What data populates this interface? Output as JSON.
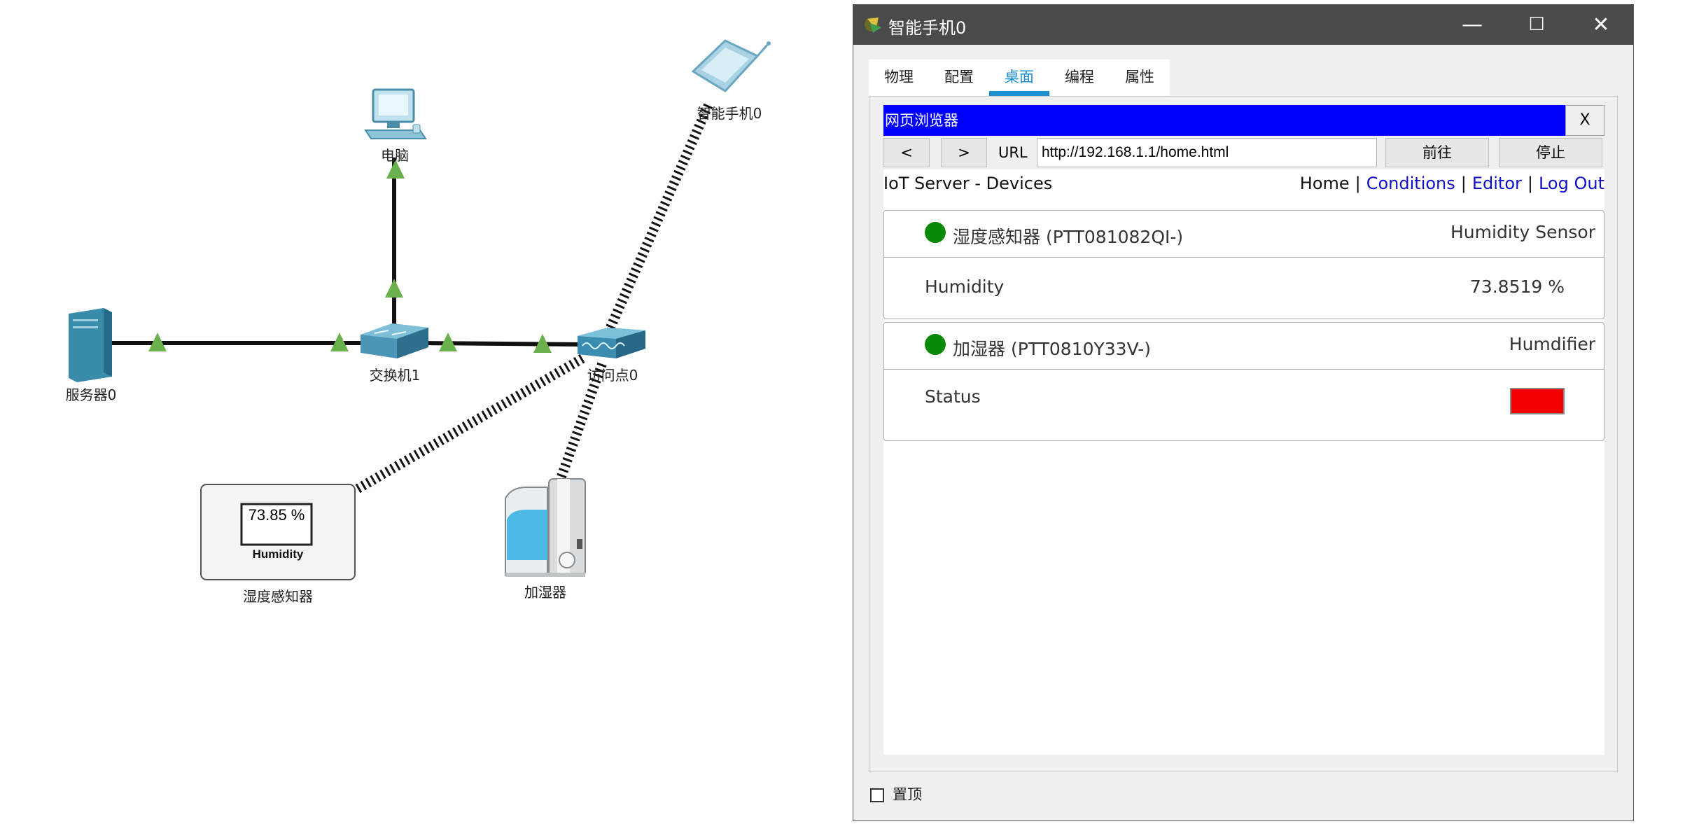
{
  "topology": {
    "devices": {
      "pc": "电脑",
      "switch": "交换机1",
      "server": "服务器0",
      "access_point": "访问点0",
      "phone": "智能手机0",
      "humidity_sensor": "湿度感知器",
      "humidifier": "加湿器"
    },
    "sensor_display": {
      "value": "73.85 %",
      "label": "Humidity"
    },
    "colors": {
      "link": "#111111",
      "port_up": "#6ab04c",
      "device": "#3f8fb0"
    }
  },
  "window": {
    "title": "智能手机0",
    "controls": {
      "minimize": "—",
      "maximize": "☐",
      "close": "✕"
    },
    "tabs": [
      {
        "label": "物理",
        "active": false
      },
      {
        "label": "配置",
        "active": false
      },
      {
        "label": "桌面",
        "active": true
      },
      {
        "label": "编程",
        "active": false
      },
      {
        "label": "属性",
        "active": false
      }
    ],
    "pin_label": "置顶",
    "pin_checked": false
  },
  "browser": {
    "title": "网页浏览器",
    "close_label": "X",
    "back_label": "<",
    "forward_label": ">",
    "url_label": "URL",
    "url": "http://192.168.1.1/home.html",
    "go_label": "前往",
    "stop_label": "停止"
  },
  "page": {
    "title": "IoT Server - Devices",
    "nav": {
      "home": "Home",
      "conditions": "Conditions",
      "editor": "Editor",
      "logout": "Log Out",
      "sep": "|"
    },
    "devices": [
      {
        "name": "湿度感知器 (PTT081082QI-)",
        "type": "Humidity Sensor",
        "field": "Humidity",
        "value": "73.8519 %",
        "status_color": "#088a08"
      },
      {
        "name": "加湿器 (PTT0810Y33V-)",
        "type": "Humdifier",
        "field": "Status",
        "value_color": "#f50000",
        "status_color": "#088a08"
      }
    ]
  },
  "accent": "#1b8fd0"
}
